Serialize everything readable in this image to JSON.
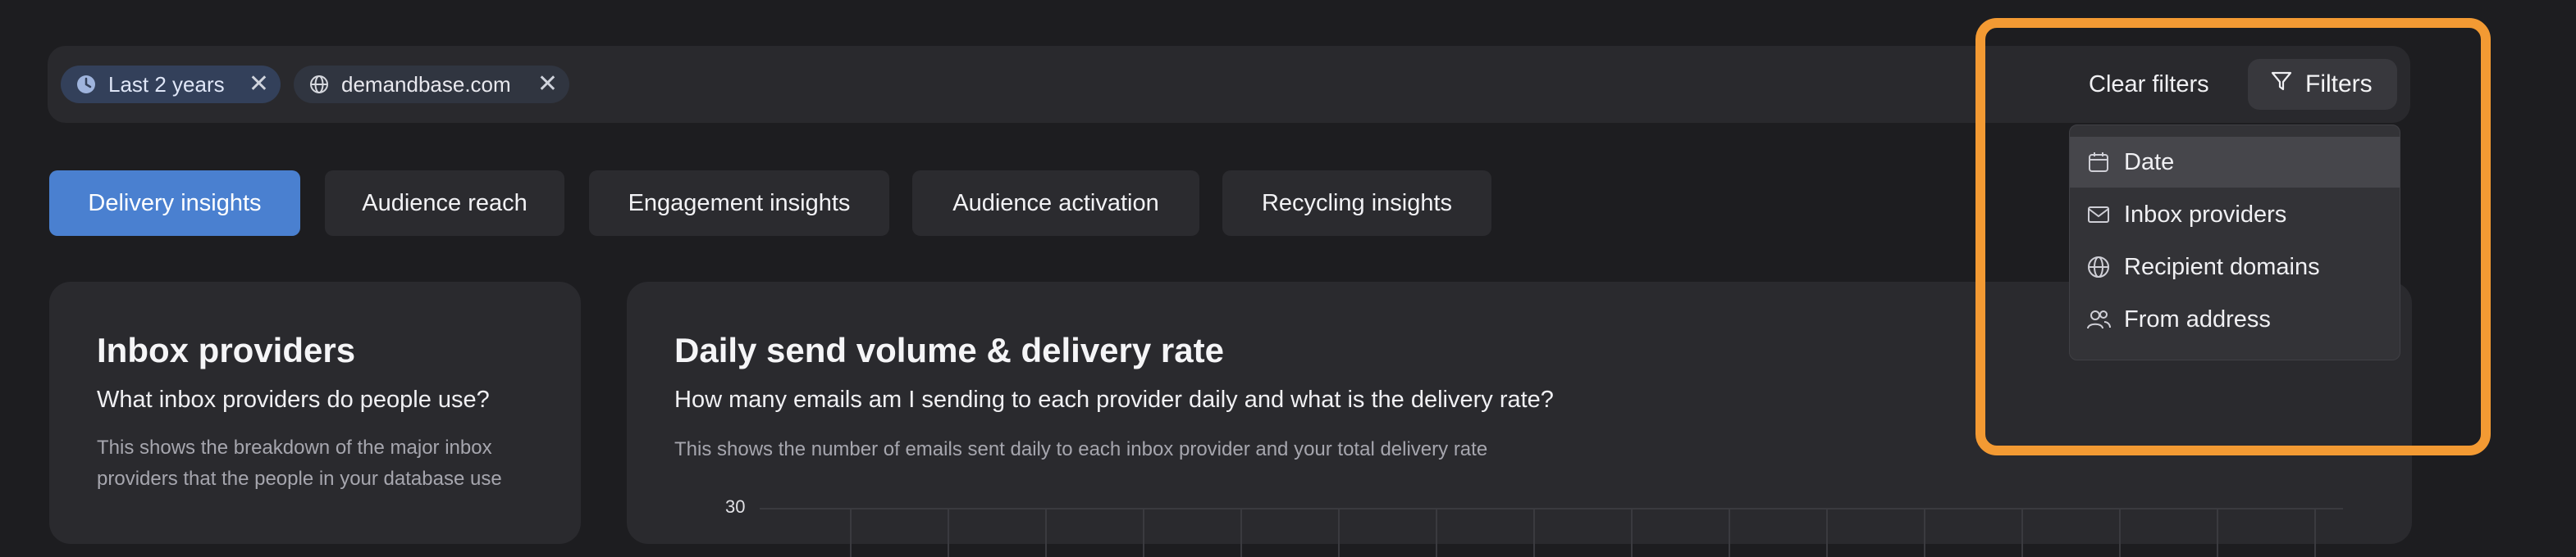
{
  "filter_bar": {
    "chips": [
      {
        "label": "Last 2 years",
        "icon": "clock-icon"
      },
      {
        "label": "demandbase.com",
        "icon": "globe-icon"
      }
    ],
    "clear_label": "Clear filters",
    "filters_label": "Filters"
  },
  "tabs": [
    {
      "label": "Delivery insights",
      "active": true
    },
    {
      "label": "Audience reach",
      "active": false
    },
    {
      "label": "Engagement insights",
      "active": false
    },
    {
      "label": "Audience activation",
      "active": false
    },
    {
      "label": "Recycling insights",
      "active": false
    }
  ],
  "filter_menu": {
    "items": [
      {
        "label": "Date",
        "icon": "calendar-icon"
      },
      {
        "label": "Inbox providers",
        "icon": "mail-icon"
      },
      {
        "label": "Recipient domains",
        "icon": "globe-icon"
      },
      {
        "label": "From address",
        "icon": "users-icon"
      }
    ]
  },
  "cards": {
    "inbox_providers": {
      "title": "Inbox providers",
      "question": "What inbox providers do people use?",
      "description": "This shows the breakdown of the major inbox providers that the people in your database use"
    },
    "daily_send": {
      "title": "Daily send volume & delivery rate",
      "question": "How many emails am I sending to each provider daily and what is the delivery rate?",
      "description": "This shows the number of emails sent daily to each inbox provider and your total delivery rate",
      "y_tick_top": "30"
    }
  },
  "colors": {
    "accent": "#4a80d0",
    "highlight": "#f39a33",
    "background": "#1d1d20"
  }
}
